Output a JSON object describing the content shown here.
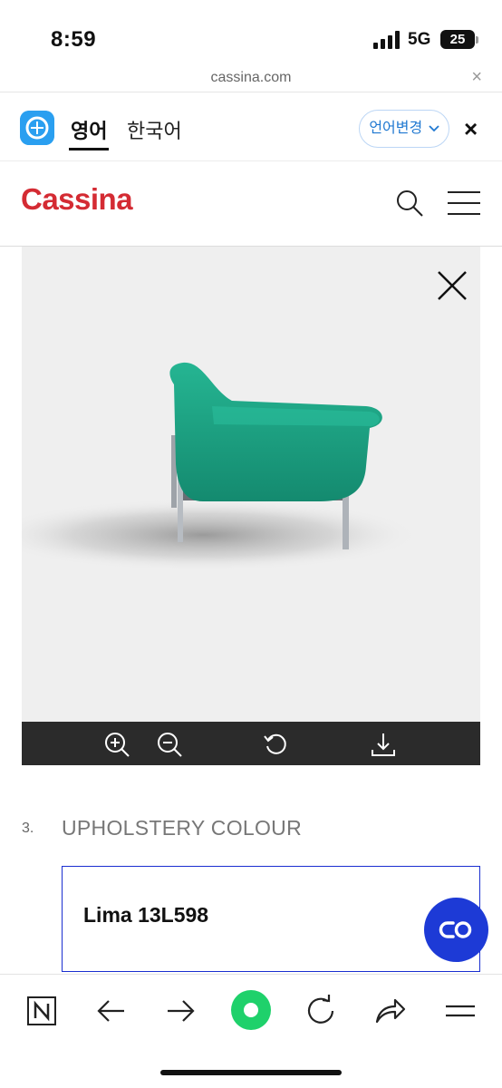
{
  "status": {
    "time": "8:59",
    "network": "5G",
    "battery": "25"
  },
  "browser": {
    "url": "cassina.com",
    "close_glyph": "×"
  },
  "translate": {
    "app_icon": "translate-app-icon",
    "language_active": "영어",
    "language_target": "한국어",
    "change_label": "언어변경",
    "close_glyph": "×"
  },
  "site": {
    "logo": "Cassina",
    "search_icon": "search-icon",
    "menu_icon": "hamburger-menu-icon"
  },
  "viewer": {
    "close_icon": "close-icon",
    "product_colour": "#1aa083",
    "tools": [
      "zoom-in-icon",
      "zoom-out-icon",
      "rotate-reset-icon",
      "download-icon"
    ]
  },
  "configurator": {
    "step_number": "3.",
    "step_title": "UPHOLSTERY COLOUR",
    "selected_option": "Lima 13L598"
  },
  "fab": {
    "icon": "chat-link-icon",
    "color": "#1d3ad6"
  },
  "bottom_nav": [
    "naver-n-icon",
    "back-arrow-icon",
    "forward-arrow-icon",
    "green-dot-home-icon",
    "reload-icon",
    "share-icon",
    "menu-icon"
  ],
  "colors": {
    "brand_red": "#d42b33",
    "accent_blue": "#1a2fd0",
    "toolbar_dark": "#2b2b2b"
  }
}
